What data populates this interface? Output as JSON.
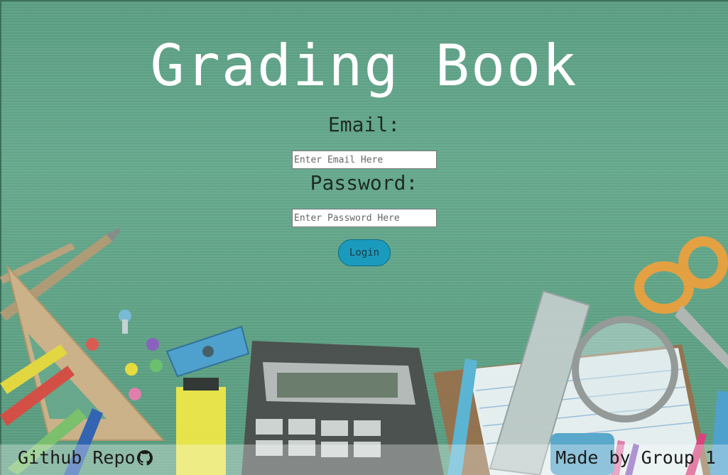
{
  "title": "Grading Book",
  "login_form": {
    "email_label": "Email:",
    "email_placeholder": "Enter Email Here",
    "password_label": "Password:",
    "password_placeholder": "Enter Password Here",
    "login_button": "Login"
  },
  "footer": {
    "github_link": "Github Repo",
    "github_icon": "github-icon",
    "credit": "Made by Group 1"
  },
  "colors": {
    "background": "#5fa487",
    "button": "#1a9bbd",
    "title": "#ffffff"
  }
}
